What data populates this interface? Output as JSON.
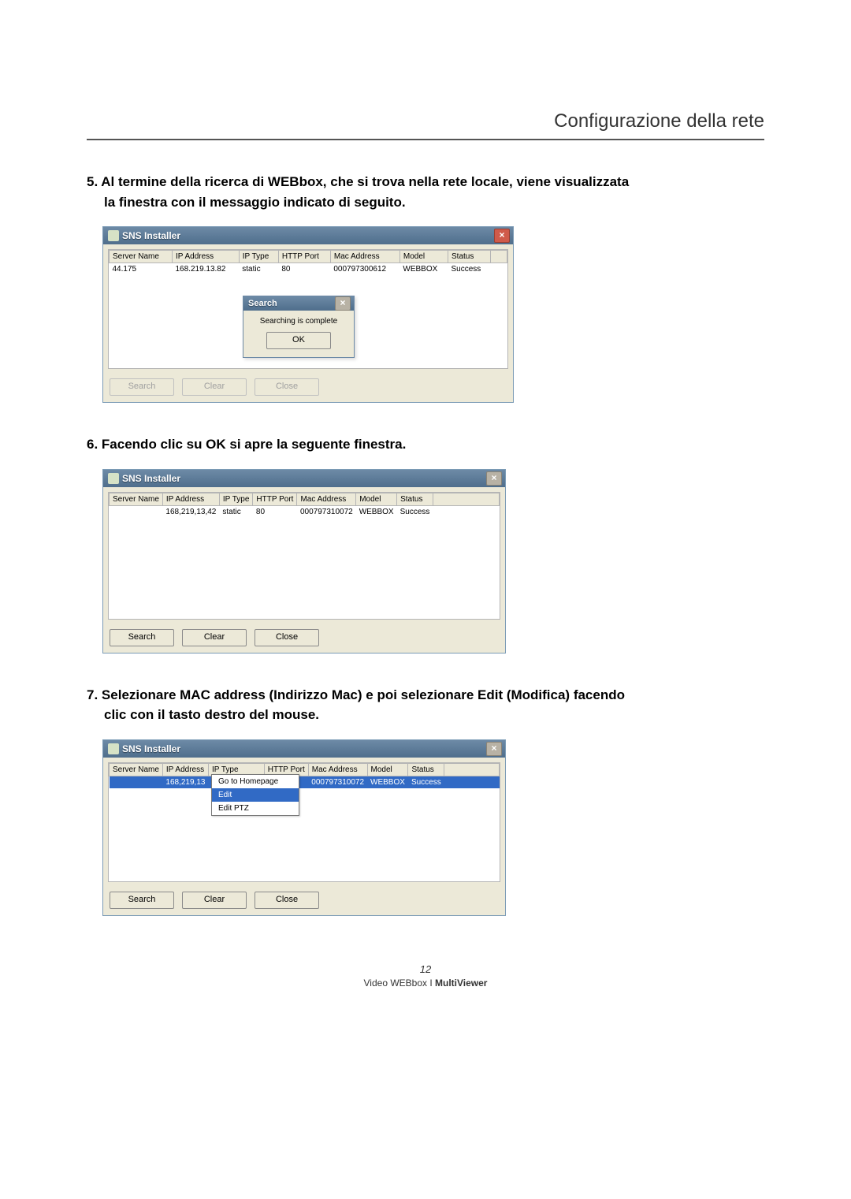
{
  "header": {
    "title": "Configurazione della rete"
  },
  "steps": {
    "s5": {
      "num": "5.",
      "line1": "Al termine della ricerca di WEBbox, che si trova nella rete locale, viene visualizzata",
      "line2": "la finestra con il messaggio indicato di seguito."
    },
    "s6": {
      "num": "6.",
      "text": "Facendo clic su OK si apre la seguente finestra."
    },
    "s7": {
      "num": "7.",
      "line1": "Selezionare MAC address (Indirizzo Mac) e poi selezionare Edit (Modifica) facendo",
      "line2": "clic con il tasto destro del mouse."
    }
  },
  "win": {
    "title": "SNS Installer",
    "close_glyph": "×",
    "headers": {
      "server": "Server Name",
      "ip": "IP Address",
      "iptype": "IP Type",
      "port": "HTTP Port",
      "mac": "Mac Address",
      "model": "Model",
      "status": "Status"
    },
    "row1": {
      "server": "44.175",
      "ip": "168.219.13.82",
      "iptype": "static",
      "port": "80",
      "mac": "000797300612",
      "model": "WEBBOX",
      "status": "Success"
    },
    "row2": {
      "server": "",
      "ip": "168,219,13,42",
      "iptype": "static",
      "port": "80",
      "mac": "000797310072",
      "model": "WEBBOX",
      "status": "Success"
    },
    "row3": {
      "server": "",
      "ip_sel": "168,219,13",
      "iptype_covered": "",
      "port": "",
      "mac": "000797310072",
      "model": "WEBBOX",
      "status": "Success"
    },
    "buttons": {
      "search": "Search",
      "clear": "Clear",
      "close": "Close"
    },
    "dialog": {
      "title": "Search",
      "msg": "Searching is complete",
      "ok": "OK"
    },
    "ctx": {
      "homepage": "Go to Homepage",
      "edit": "Edit",
      "editptz": "Edit PTZ"
    }
  },
  "footer": {
    "page": "12",
    "product": "Video WEBbox I ",
    "bold": "MultiViewer"
  }
}
